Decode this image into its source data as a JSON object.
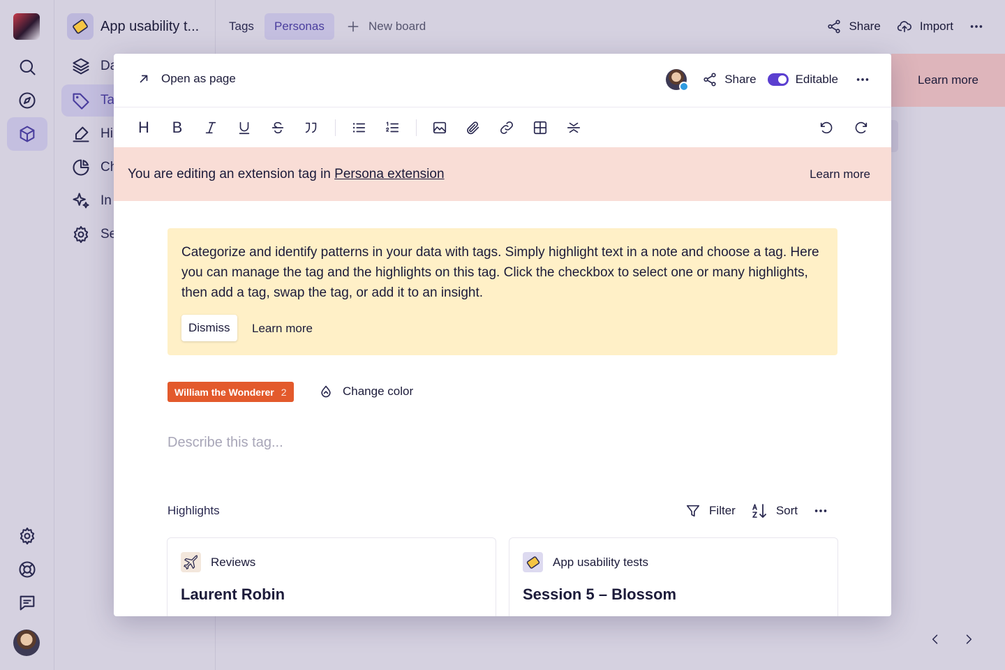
{
  "app": {
    "project_title": "App usability t...",
    "accent_color": "#5b3fd0"
  },
  "rail": {
    "items": [
      "logo",
      "search-icon",
      "compass-icon",
      "cube-icon"
    ],
    "bottom": [
      "gear-icon",
      "lifebuoy-icon",
      "chat-icon",
      "avatar"
    ]
  },
  "sidebar": {
    "items": [
      {
        "label": "Da",
        "icon": "layers-icon"
      },
      {
        "label": "Ta",
        "icon": "tag-icon"
      },
      {
        "label": "Hi",
        "icon": "highlighter-icon"
      },
      {
        "label": "Ch",
        "icon": "pie-chart-icon"
      },
      {
        "label": "In",
        "icon": "sparkles-icon"
      },
      {
        "label": "Se",
        "icon": "gear-icon"
      }
    ]
  },
  "topbar": {
    "tabs": [
      {
        "label": "Tags",
        "active": false
      },
      {
        "label": "Personas",
        "active": true
      }
    ],
    "new_board": "New board",
    "share": "Share",
    "import": "Import"
  },
  "background": {
    "learn_more": "Learn more"
  },
  "modal": {
    "open_as_page": "Open as page",
    "share": "Share",
    "editable": "Editable",
    "toolbar": {
      "heading": "H",
      "bold": "B"
    },
    "extension_banner": {
      "text": "You are editing an extension tag in ",
      "link": "Persona extension",
      "learn_more": "Learn more"
    },
    "info": {
      "text": "Categorize and identify patterns in your data with tags. Simply highlight text in a note and choose a tag. Here you can manage the tag and the highlights on this tag. Click the checkbox to select one or many highlights, then add a tag, swap the tag, or add it to an insight.",
      "dismiss": "Dismiss",
      "learn_more": "Learn more"
    },
    "tag": {
      "name": "William the Wonderer",
      "count": "2",
      "color": "#e35a2c",
      "change_color": "Change color"
    },
    "description_placeholder": "Describe this tag...",
    "highlights": {
      "label": "Highlights",
      "filter": "Filter",
      "sort": "Sort",
      "cards": [
        {
          "source": "Reviews",
          "title": "Laurent Robin",
          "icon": "airplane-icon"
        },
        {
          "source": "App usability tests",
          "title": "Session 5 – Blossom",
          "icon": "ticket-icon"
        }
      ]
    }
  }
}
